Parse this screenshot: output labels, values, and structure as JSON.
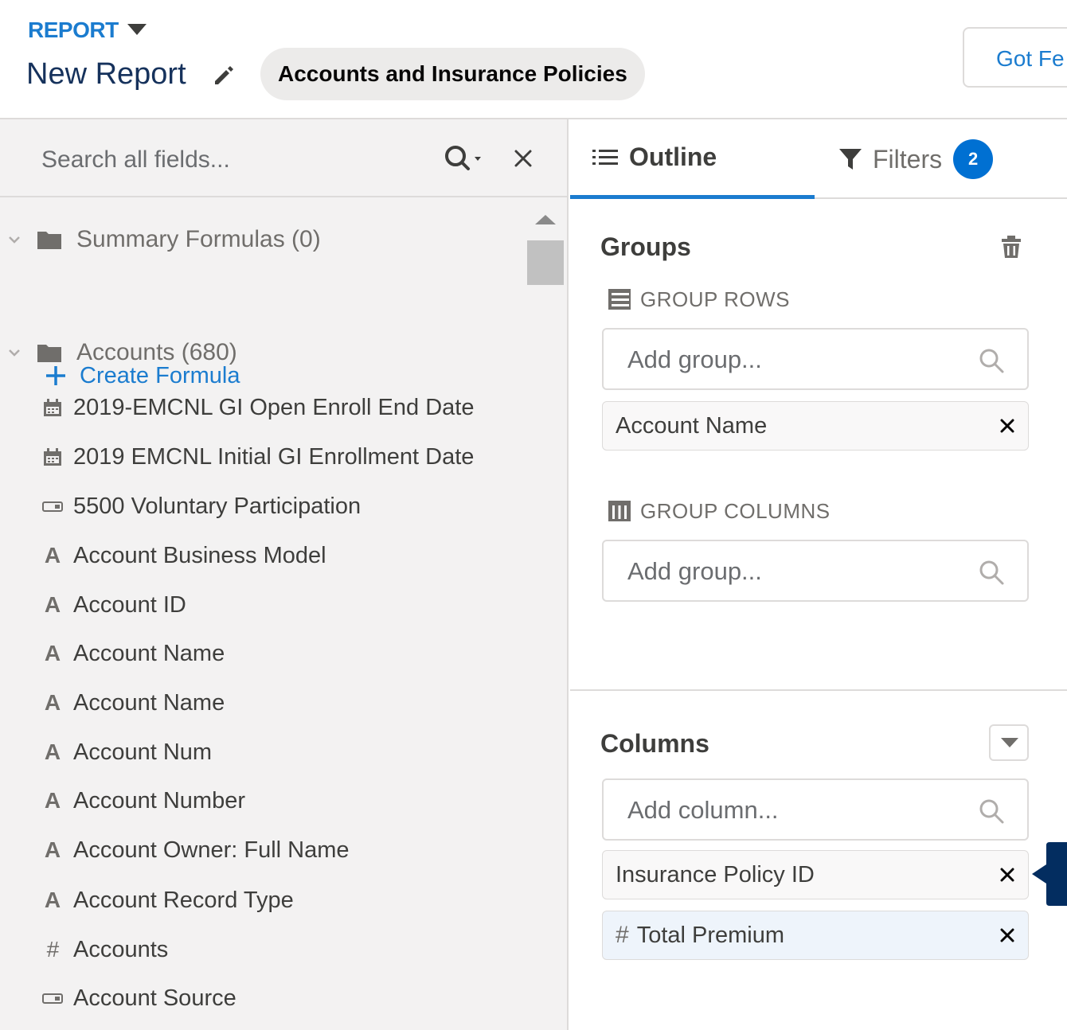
{
  "header": {
    "object_label": "REPORT",
    "report_name": "New Report",
    "report_type": "Accounts and Insurance Policies",
    "feedback_button": "Got Fe"
  },
  "field_panel": {
    "search_placeholder": "Search all fields...",
    "folders": [
      {
        "label": "Summary Formulas (0)"
      },
      {
        "label": "Accounts (680)"
      }
    ],
    "create_formula": "Create Formula",
    "fields": [
      {
        "icon": "calendar-icon",
        "label": "2019-EMCNL GI Open Enroll End Date"
      },
      {
        "icon": "calendar-icon",
        "label": "2019 EMCNL Initial GI Enrollment Date"
      },
      {
        "icon": "picklist-icon",
        "label": "5500 Voluntary Participation"
      },
      {
        "icon": "text-icon",
        "label": "Account Business Model"
      },
      {
        "icon": "text-icon",
        "label": "Account ID"
      },
      {
        "icon": "text-icon",
        "label": "Account Name"
      },
      {
        "icon": "text-icon",
        "label": "Account Name"
      },
      {
        "icon": "text-icon",
        "label": "Account Num"
      },
      {
        "icon": "text-icon",
        "label": "Account Number"
      },
      {
        "icon": "text-icon",
        "label": "Account Owner: Full Name"
      },
      {
        "icon": "text-icon",
        "label": "Account Record Type"
      },
      {
        "icon": "number-icon",
        "label": "Accounts"
      },
      {
        "icon": "picklist-icon",
        "label": "Account Source"
      }
    ]
  },
  "outline_panel": {
    "tabs": {
      "outline": "Outline",
      "filters": "Filters",
      "filters_count": "2"
    },
    "groups": {
      "title": "Groups",
      "group_rows_label": "GROUP ROWS",
      "group_rows_placeholder": "Add group...",
      "group_rows_items": [
        "Account Name"
      ],
      "group_columns_label": "GROUP COLUMNS",
      "group_columns_placeholder": "Add group..."
    },
    "columns": {
      "title": "Columns",
      "placeholder": "Add column...",
      "items": [
        "Insurance Policy ID",
        "Total Premium"
      ],
      "number_symbol": "#"
    }
  },
  "colors": {
    "accent_blue": "#1b7ccf",
    "badge_blue": "#0070d2",
    "panel_gray": "#f3f2f2",
    "border": "#dddbda"
  }
}
